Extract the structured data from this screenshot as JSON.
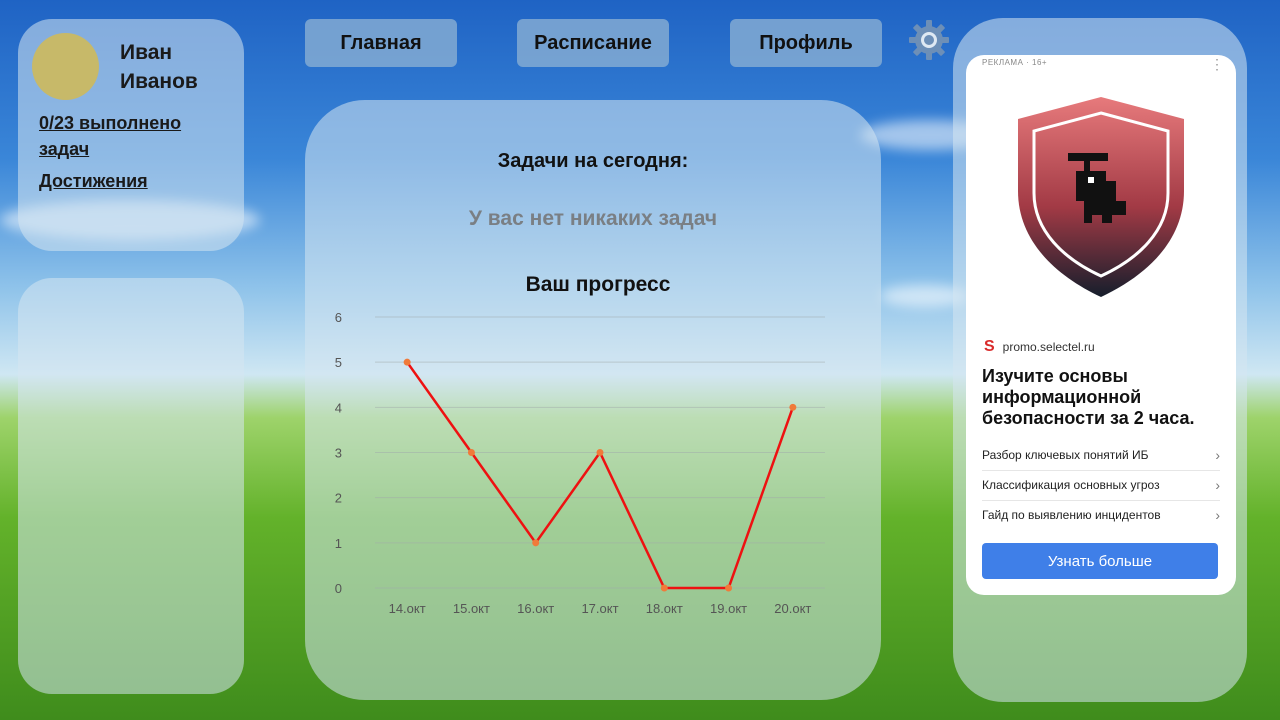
{
  "profile": {
    "name": "Иван Иванов",
    "tasks_done": "0/23 выполнено задач",
    "achievements": "Достижения"
  },
  "nav": {
    "home": "Главная",
    "schedule": "Расписание",
    "profile": "Профиль"
  },
  "main": {
    "tasks_title": "Задачи на сегодня:",
    "no_tasks": "У вас нет никаких задач",
    "progress_title": "Ваш прогресс"
  },
  "chart_data": {
    "type": "line",
    "categories": [
      "14.окт",
      "15.окт",
      "16.окт",
      "17.окт",
      "18.окт",
      "19.окт",
      "20.окт"
    ],
    "values": [
      5,
      3,
      1,
      3,
      0,
      0,
      4
    ],
    "ylim": [
      0,
      6
    ],
    "yticks": [
      0,
      1,
      2,
      3,
      4,
      5,
      6
    ],
    "line_color": "#ee1111",
    "marker_color": "#f07a3a",
    "grid": true
  },
  "ad": {
    "label": "РЕКЛАМА · 16+",
    "source": "promo.selectel.ru",
    "headline": "Изучите основы информационной безопасности за 2 часа.",
    "items": [
      "Разбор ключевых понятий ИБ",
      "Классификация основных угроз",
      "Гайд по выявлению инцидентов"
    ],
    "button": "Узнать больше"
  },
  "colors": {
    "nav_button": "#82aad2",
    "avatar": "#c7b969",
    "ad_button": "#3f7fe8"
  }
}
